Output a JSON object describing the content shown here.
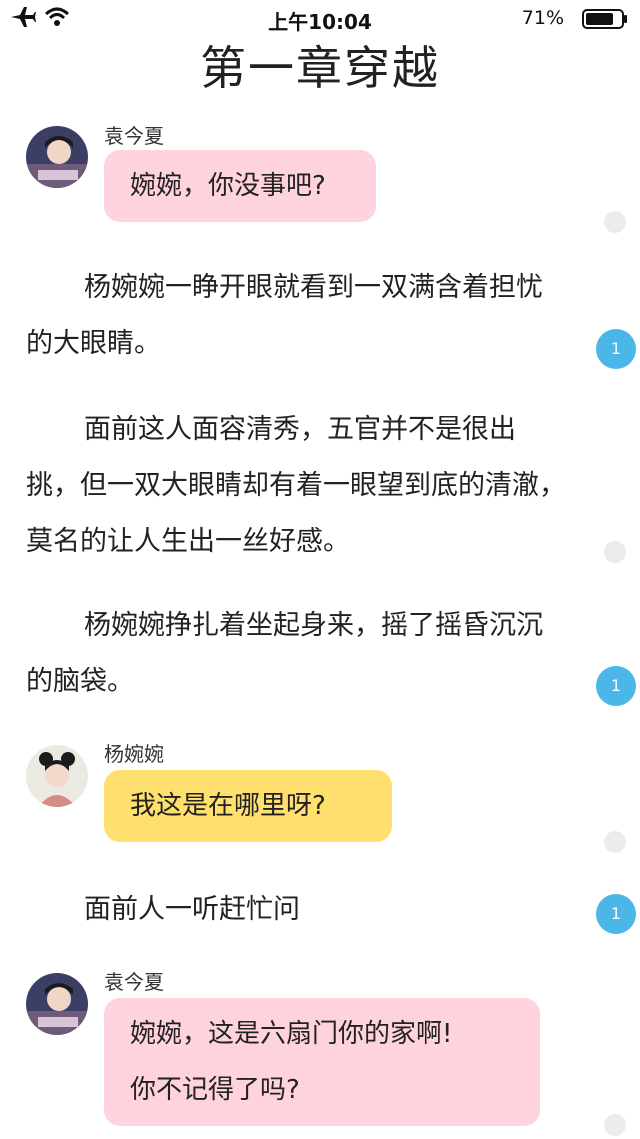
{
  "status_bar": {
    "time": "上午10:04",
    "battery_percent": "71%",
    "battery_level": 0.71,
    "icons": [
      "airplane-icon",
      "wifi-icon",
      "battery-icon"
    ]
  },
  "chapter_title": "第一章穿越",
  "messages": [
    {
      "type": "chat",
      "speaker": "袁今夏",
      "text": "婉婉，你没事吧?",
      "bubble_color": "#ffd3dd"
    },
    {
      "type": "narration",
      "text": "杨婉婉一睁开眼就看到一双满含着担忧的大眼睛。",
      "comment_count": "1"
    },
    {
      "type": "narration",
      "text": "面前这人面容清秀，五官并不是很出挑，但一双大眼睛却有着一眼望到底的清澈，莫名的让人生出一丝好感。"
    },
    {
      "type": "narration",
      "text": "杨婉婉挣扎着坐起身来，摇了摇昏沉沉的脑袋。",
      "comment_count": "1"
    },
    {
      "type": "chat",
      "speaker": "杨婉婉",
      "text": "我这是在哪里呀?",
      "bubble_color": "#ffdf6e"
    },
    {
      "type": "narration",
      "text": "面前人一听赶忙问",
      "comment_count": "1"
    },
    {
      "type": "chat",
      "speaker": "袁今夏",
      "text_line1": "婉婉，这是六扇门你的家啊!",
      "text_line2": "你不记得了吗?",
      "bubble_color": "#ffd3dd"
    }
  ],
  "colors": {
    "accent_badge": "#4ab7e8",
    "pink_bubble": "#ffd3dd",
    "yellow_bubble": "#ffdf6e"
  }
}
